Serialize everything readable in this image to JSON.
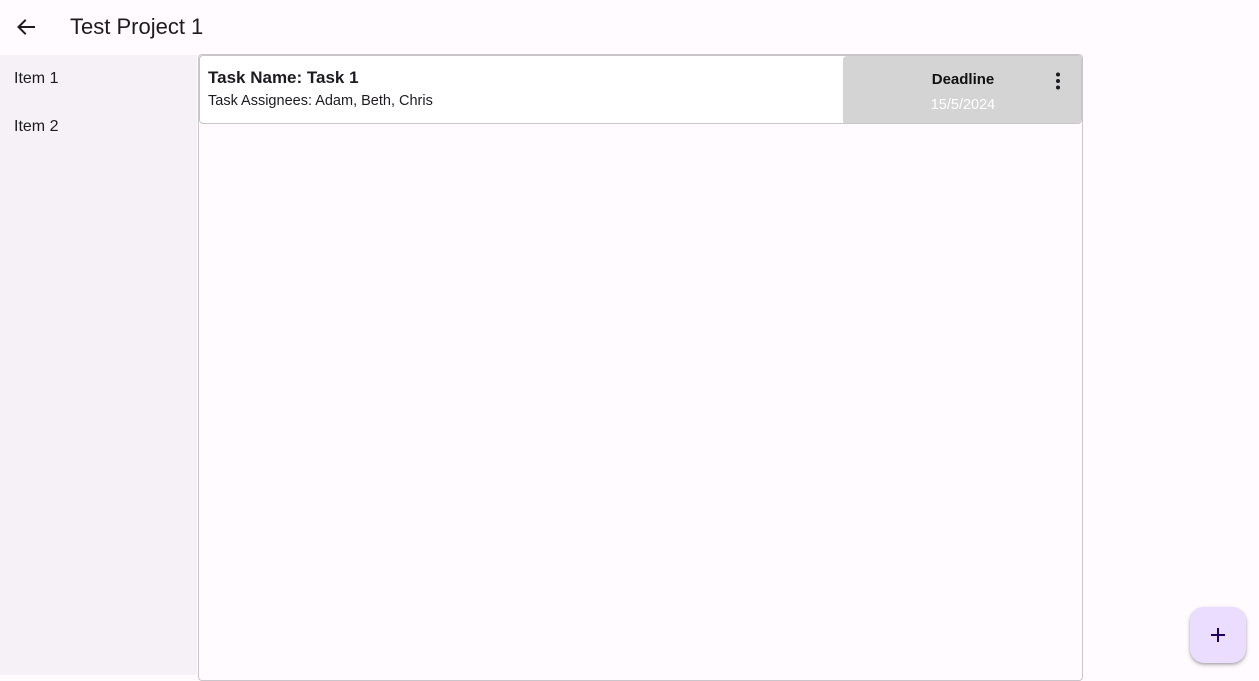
{
  "appbar": {
    "title": "Test Project 1",
    "back_icon": "arrow-left-icon"
  },
  "sidebar": {
    "items": [
      {
        "label": "Item 1"
      },
      {
        "label": "Item 2"
      }
    ]
  },
  "tasks": [
    {
      "name": "Task Name: Task 1",
      "assignees": "Task Assignees: Adam, Beth, Chris",
      "deadline_label": "Deadline",
      "deadline_date": "15/5/2024",
      "menu_icon": "more-vert-icon"
    }
  ],
  "fab": {
    "icon": "plus-icon",
    "color": "#eaddff"
  },
  "colors": {
    "background": "#fffbff",
    "sidebar": "#f5f1f7",
    "deadline_box": "#d4d4d4",
    "border": "#c9c5ca"
  }
}
